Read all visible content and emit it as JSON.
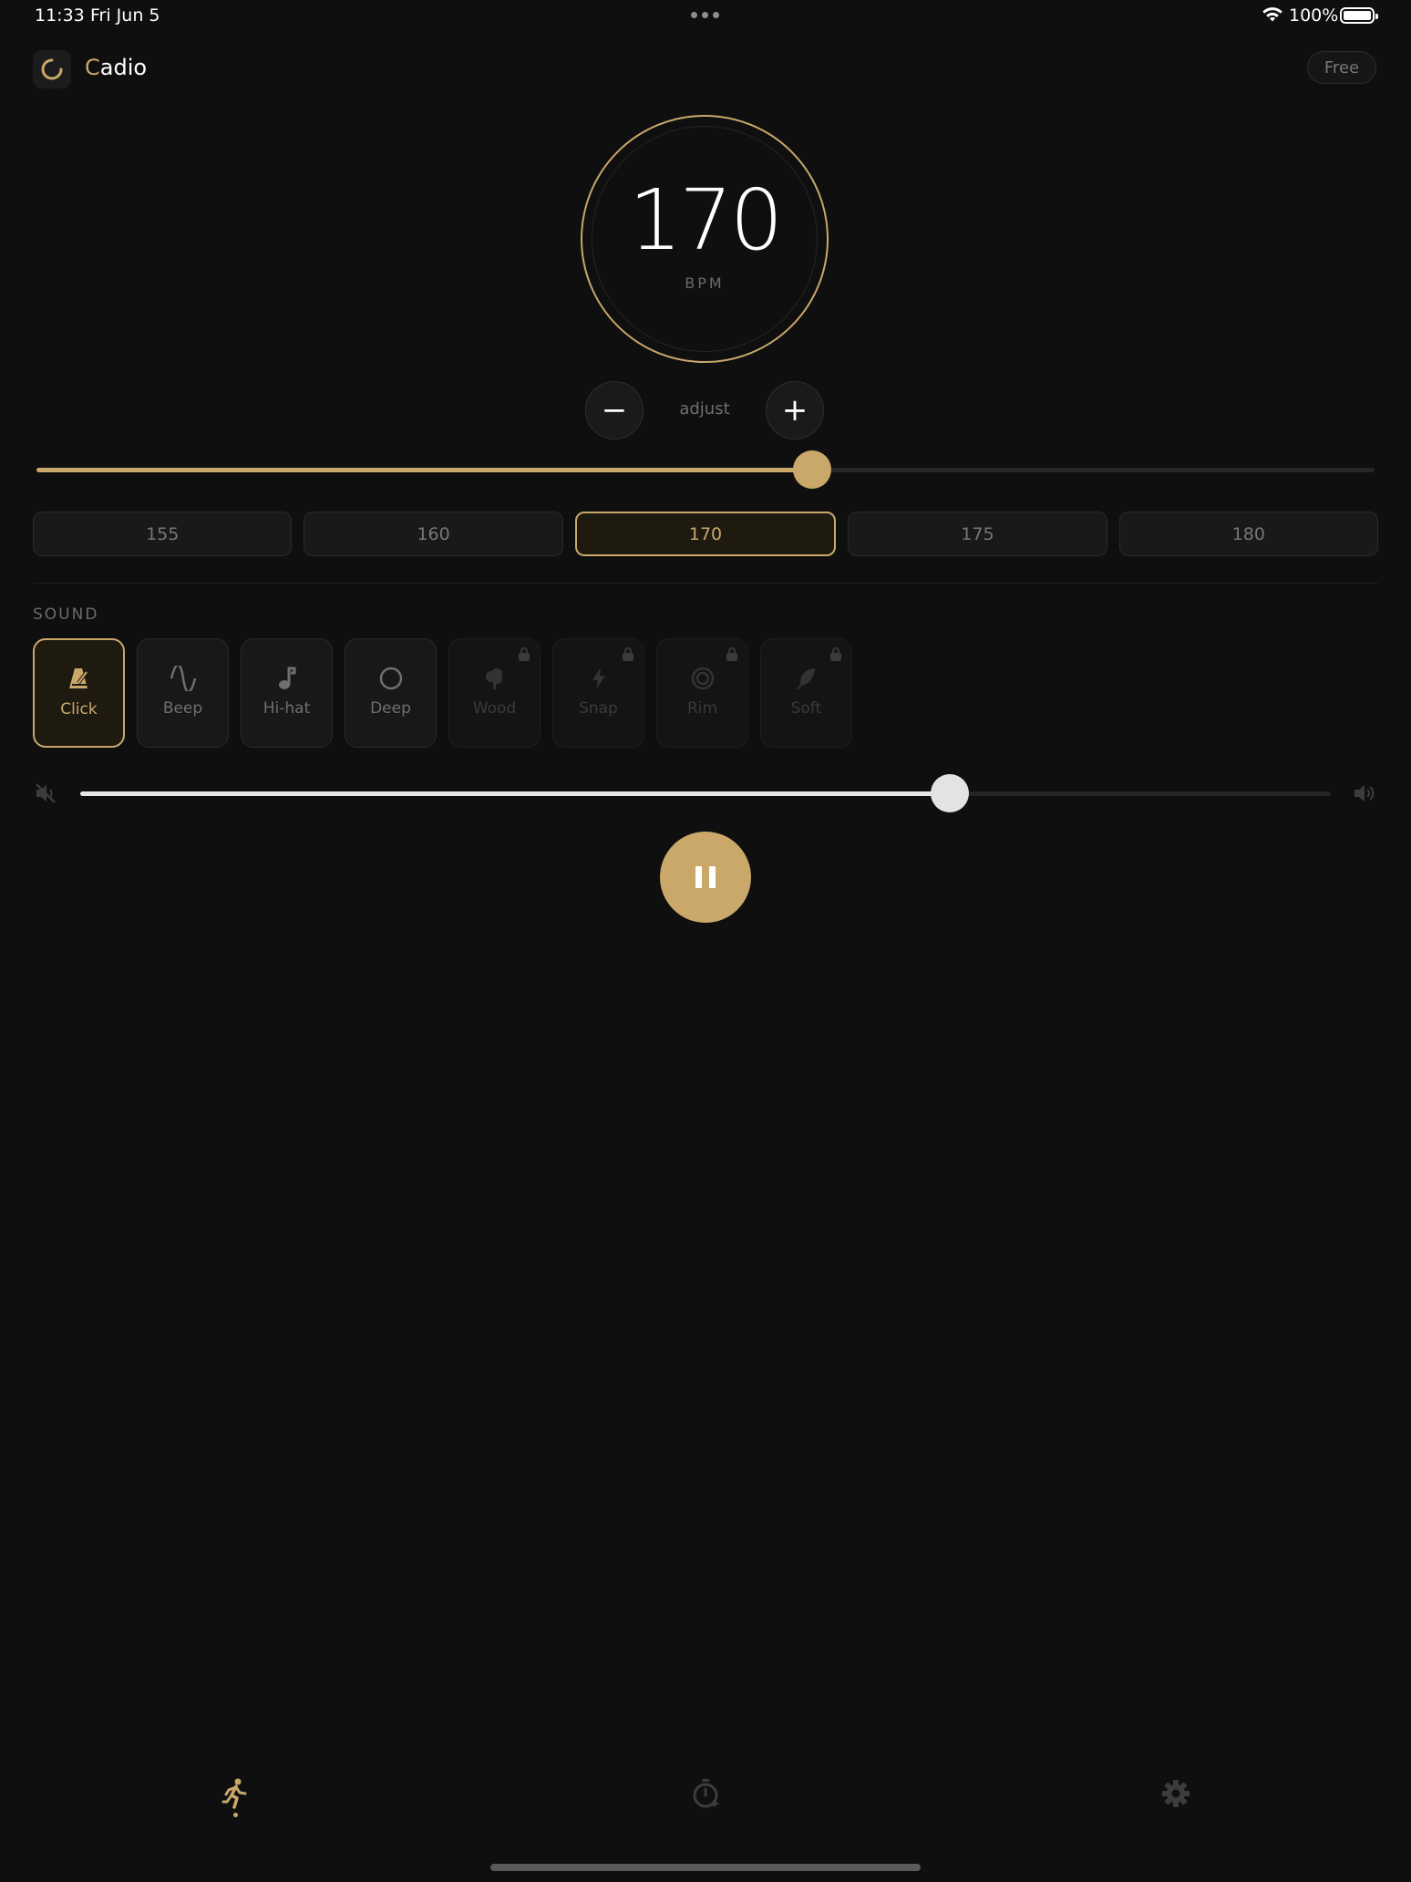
{
  "status_bar": {
    "time": "11:33",
    "date": "Fri Jun 5",
    "battery": "100%",
    "icons": [
      "more-dots-icon",
      "wifi-icon",
      "battery-icon"
    ]
  },
  "header": {
    "title_initial": "C",
    "title_rest": "adio",
    "plan_badge": "Free",
    "logo_icon": "loading-arc-icon"
  },
  "tempo": {
    "bpm": "170",
    "unit": "BPM",
    "adjust_label": "adjust",
    "minus_label": "−",
    "plus_label": "+",
    "slider_fraction": 0.58,
    "presets": [
      {
        "label": "155",
        "active": false
      },
      {
        "label": "160",
        "active": false
      },
      {
        "label": "170",
        "active": true
      },
      {
        "label": "175",
        "active": false
      },
      {
        "label": "180",
        "active": false
      }
    ]
  },
  "sound": {
    "section_label": "SOUND",
    "options": [
      {
        "label": "Click",
        "icon": "metronome-icon",
        "active": true,
        "locked": false
      },
      {
        "label": "Beep",
        "icon": "sine-wave-icon",
        "active": false,
        "locked": false
      },
      {
        "label": "Hi-hat",
        "icon": "music-note-icon",
        "active": false,
        "locked": false
      },
      {
        "label": "Deep",
        "icon": "circle-icon",
        "active": false,
        "locked": false
      },
      {
        "label": "Wood",
        "icon": "tree-icon",
        "active": false,
        "locked": true
      },
      {
        "label": "Snap",
        "icon": "bolt-icon",
        "active": false,
        "locked": true
      },
      {
        "label": "Rim",
        "icon": "target-icon",
        "active": false,
        "locked": true
      },
      {
        "label": "Soft",
        "icon": "feather-icon",
        "active": false,
        "locked": true
      }
    ]
  },
  "volume": {
    "level_fraction": 0.695,
    "min_icon": "speaker-muted-icon",
    "max_icon": "speaker-loud-icon"
  },
  "playback": {
    "state": "playing",
    "icon": "pause-icon"
  },
  "tab_bar": {
    "tabs": [
      {
        "name": "run",
        "icon": "running-person-icon",
        "active": true
      },
      {
        "name": "timer",
        "icon": "stopwatch-icon",
        "active": false
      },
      {
        "name": "settings",
        "icon": "gear-icon",
        "active": false
      }
    ]
  },
  "colors": {
    "accent": "#c9a86a",
    "background": "#0f0f0f",
    "surface": "#191919",
    "muted_text": "#6f6f6f"
  }
}
